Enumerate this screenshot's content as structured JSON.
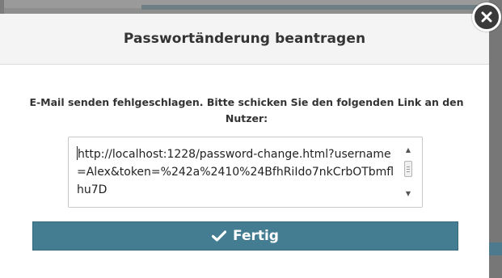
{
  "dialog": {
    "title": "Passwortänderung beantragen",
    "message": "E-Mail senden fehlgeschlagen. Bitte schicken Sie den folgenden Link an den Nutzer:",
    "link_text": "http://localhost:1228/password-change.html?username=Alex&token=%242a%2410%24BfhRiIdo7nkCrbOTbmflhu7D",
    "done_label": "Fertig",
    "close_icon": "close-icon",
    "done_icon": "check-icon"
  },
  "colors": {
    "button": "#447d91",
    "header_bg": "#f4f4f4",
    "overlay": "#8e8e8e"
  }
}
